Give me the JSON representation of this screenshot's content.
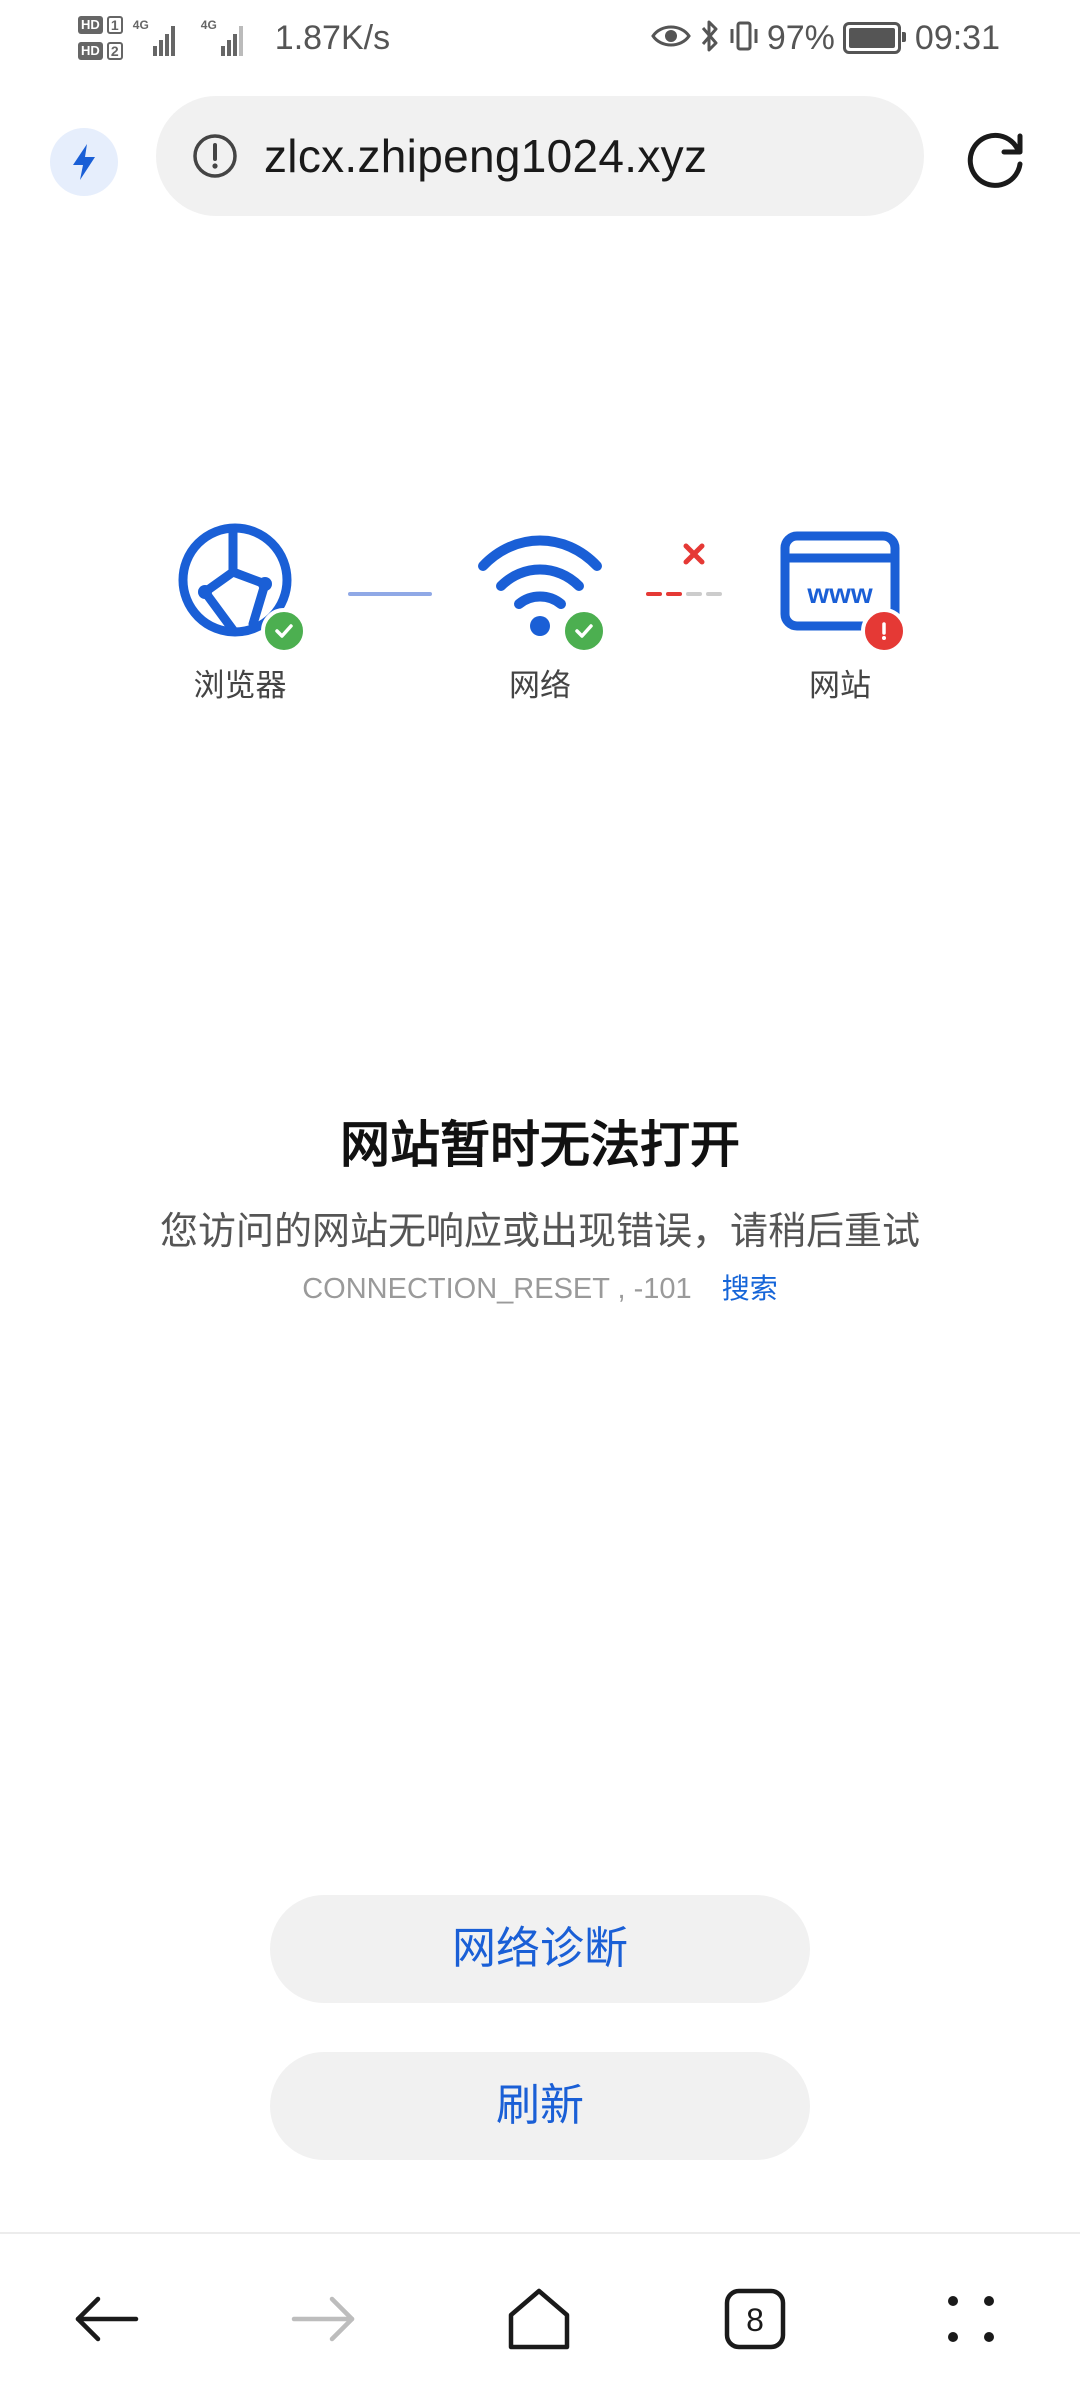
{
  "status_bar": {
    "hd1": "HD",
    "hd1_num": "1",
    "hd2": "HD",
    "hd2_num": "2",
    "net1": "4G",
    "net2": "4G",
    "speed": "1.87K/s",
    "battery_pct": "97%",
    "time": "09:31",
    "icons": [
      "eye-icon",
      "bluetooth-icon",
      "vibrate-icon",
      "battery-icon"
    ]
  },
  "toolbar": {
    "url": "zlcx.zhipeng1024.xyz",
    "icons": [
      "bolt-icon",
      "info-icon",
      "reload-icon"
    ]
  },
  "diagnostic": {
    "browser_label": "浏览器",
    "network_label": "网络",
    "website_label": "网站",
    "www_text": "www",
    "browser_status": "ok",
    "network_status": "ok",
    "website_status": "error"
  },
  "error": {
    "title": "网站暂时无法打开",
    "description": "您访问的网站无响应或出现错误，请稍后重试",
    "code": "CONNECTION_RESET , -101",
    "search_link": "搜索"
  },
  "actions": {
    "diagnose_label": "网络诊断",
    "refresh_label": "刷新"
  },
  "bottom_nav": {
    "tab_count": "8",
    "icons": [
      "back-icon",
      "forward-icon",
      "home-icon",
      "tabs-icon",
      "menu-icon"
    ]
  },
  "colors": {
    "accent_blue": "#1565d8",
    "ok_green": "#4caf50",
    "error_red": "#e53935",
    "pill_bg": "#f1f1f1"
  }
}
